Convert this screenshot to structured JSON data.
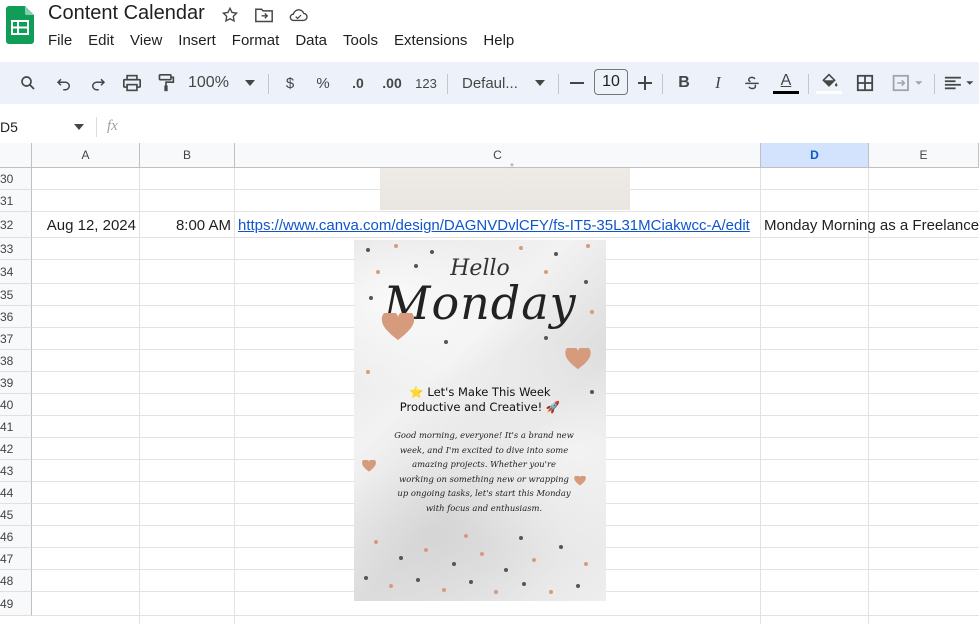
{
  "app": {
    "doc_title": "Content Calendar",
    "title_icons": [
      "star-icon",
      "move-to-folder-icon",
      "cloud-saved-icon"
    ]
  },
  "menu": [
    "File",
    "Edit",
    "View",
    "Insert",
    "Format",
    "Data",
    "Tools",
    "Extensions",
    "Help"
  ],
  "toolbar": {
    "zoom": "100%",
    "currency": "$",
    "percent": "%",
    "dec_decrease": ".0",
    "dec_increase": ".00",
    "number_format": "123",
    "font_family": "Defaul...",
    "font_size": "10",
    "bold": "B",
    "italic": "I",
    "text_color": "A",
    "colors": {
      "toolbar_bg": "#edf2fa",
      "text_color_bar": "#000000"
    }
  },
  "formula_bar": {
    "name_box": "D5",
    "fx": "fx"
  },
  "grid": {
    "columns": [
      "A",
      "B",
      "C",
      "D",
      "E"
    ],
    "selected_column": "D",
    "rows": [
      "30",
      "31",
      "32",
      "33",
      "34",
      "35",
      "36",
      "37",
      "38",
      "39",
      "40",
      "41",
      "42",
      "43",
      "44",
      "45",
      "46",
      "47",
      "48",
      "49"
    ],
    "row32": {
      "date": "Aug 12, 2024",
      "time": "8:00 AM",
      "link": "https://www.canva.com/design/DAGNVDvlCFY/fs-IT5-35L31MCiakwcc-A/edit",
      "title": "Monday Morning as a Freelancer"
    }
  },
  "poster": {
    "hello": "Hello",
    "monday": "Monday",
    "headline_1": "⭐ Let's Make This Week",
    "headline_2": "Productive and Creative! 🚀",
    "body": "Good morning, everyone! It's a brand new week, and I'm excited to dive into some amazing projects. Whether you're working on something new or wrapping up ongoing tasks, let's start this Monday with focus and enthusiasm."
  }
}
